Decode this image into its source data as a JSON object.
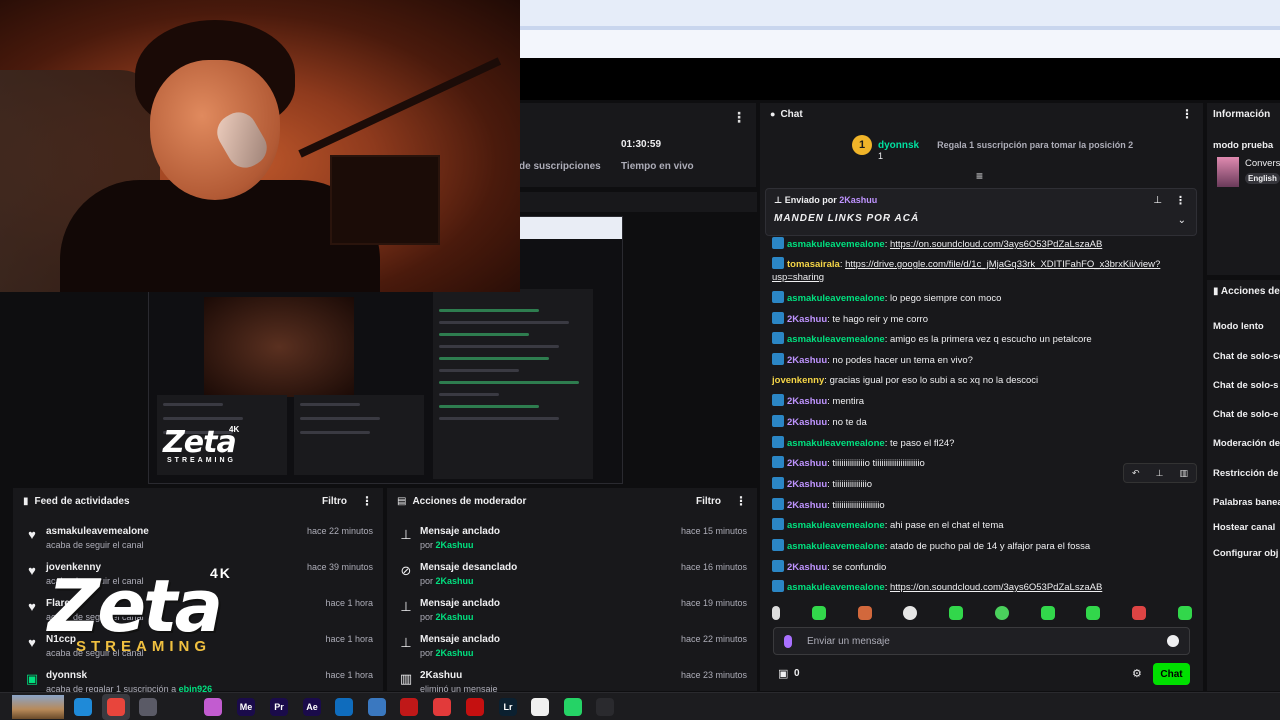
{
  "stats": {
    "subs_label": "de suscripciones",
    "time_value": "01:30:59",
    "time_label": "Tiempo en vivo"
  },
  "feed": {
    "title": "Feed de actividades",
    "filter": "Filtro",
    "items": [
      {
        "name": "asmakuleavemealone",
        "sub": "acaba de seguir el canal",
        "time": "hace 22 minutos"
      },
      {
        "name": "jovenkenny",
        "sub": "acaba de seguir el canal",
        "time": "hace 39 minutos"
      },
      {
        "name": "Flarex",
        "sub": "acaba de seguir el canal",
        "time": "hace 1 hora"
      },
      {
        "name": "N1ccp",
        "sub": "acaba de seguir el canal",
        "time": "hace 1 hora"
      },
      {
        "name": "dyonnsk",
        "sub": "acaba de regalar 1 suscripción a",
        "sub_user": "ebin926",
        "time": "hace 1 hora"
      }
    ]
  },
  "mod": {
    "title": "Acciones de moderador",
    "filter": "Filtro",
    "items": [
      {
        "name": "Mensaje anclado",
        "by": "por",
        "user": "2Kashuu",
        "time": "hace 15 minutos",
        "icon": "pin-icon"
      },
      {
        "name": "Mensaje desanclado",
        "by": "por",
        "user": "2Kashuu",
        "time": "hace 16 minutos",
        "icon": "unpin-icon"
      },
      {
        "name": "Mensaje anclado",
        "by": "por",
        "user": "2Kashuu",
        "time": "hace 19 minutos",
        "icon": "pin-icon"
      },
      {
        "name": "Mensaje anclado",
        "by": "por",
        "user": "2Kashuu",
        "time": "hace 22 minutos",
        "icon": "pin-icon"
      },
      {
        "name": "2Kashuu",
        "by": "eliminó un mensaje",
        "user": "",
        "time": "hace 23 minutos",
        "icon": "trash-icon"
      }
    ]
  },
  "chat": {
    "title": "Chat",
    "leader": {
      "rank": "1",
      "name": "dyonnsk",
      "count": "1",
      "gift_text": "Regala 1 suscripción para tomar la posición 2"
    },
    "pinned": {
      "by_label": "Enviado por",
      "by_user": "2Kashuu",
      "message": "MANDEN LINKS POR ACÁ"
    },
    "messages": [
      {
        "user": "asmakuleavemealone",
        "color": "green",
        "badge": true,
        "text": "https://on.soundcloud.com/3ays6O53PdZaLszaAB",
        "link": true
      },
      {
        "user": "tomasairala",
        "color": "yellow",
        "badge": true,
        "text": "https://drive.google.com/file/d/1c_jMjaGq33rk_XDITIFahFO_x3brxKii/view?usp=sharing",
        "link": true
      },
      {
        "user": "asmakuleavemealone",
        "color": "green",
        "badge": true,
        "text": "lo pego siempre con moco"
      },
      {
        "user": "2Kashuu",
        "color": "purple",
        "badge": true,
        "text": "te hago reir y me corro"
      },
      {
        "user": "asmakuleavemealone",
        "color": "green",
        "badge": true,
        "text": "amigo es la primera vez q escucho un petalcore"
      },
      {
        "user": "2Kashuu",
        "color": "purple",
        "badge": true,
        "text": "no podes hacer un tema en vivo?"
      },
      {
        "user": "jovenkenny",
        "color": "yellow",
        "badge": false,
        "text": "gracias igual por eso lo subi a sc xq no la descoci"
      },
      {
        "user": "2Kashuu",
        "color": "purple",
        "badge": true,
        "text": "mentira"
      },
      {
        "user": "2Kashuu",
        "color": "purple",
        "badge": true,
        "text": "no te da"
      },
      {
        "user": "asmakuleavemealone",
        "color": "green",
        "badge": true,
        "text": "te paso el fl24?"
      },
      {
        "user": "2Kashuu",
        "color": "purple",
        "badge": true,
        "text": "tiiiiiiiiiiiiiio tiiiiiiiiiiiiiiiiiiiiio"
      },
      {
        "user": "2Kashuu",
        "color": "purple",
        "badge": true,
        "text": "tiiiiiiiiiiiiiiio"
      },
      {
        "user": "2Kashuu",
        "color": "purple",
        "badge": true,
        "text": "tiiiiiiiiiiiiiiiiiiiiio"
      },
      {
        "user": "asmakuleavemealone",
        "color": "green",
        "badge": true,
        "text": "ahi pase en el chat el tema"
      },
      {
        "user": "asmakuleavemealone",
        "color": "green",
        "badge": true,
        "text": "atado de pucho pal de 14 y alfajor para el fossa"
      },
      {
        "user": "2Kashuu",
        "color": "purple",
        "badge": true,
        "text": "se confundio"
      },
      {
        "user": "asmakuleavemealone",
        "color": "green",
        "badge": true,
        "text": "https://on.soundcloud.com/3ays6O53PdZaLszaAB",
        "link": true
      }
    ],
    "input_placeholder": "Enviar un mensaje",
    "points": "0",
    "send_label": "Chat"
  },
  "info": {
    "title": "Información",
    "mode": "modo prueba",
    "conv": "Convers",
    "lang": "English"
  },
  "actions": {
    "title": "Acciones de",
    "items": [
      "Modo lento",
      "Chat de solo-se",
      "Chat de solo-s",
      "Chat de solo-e",
      "Moderación de",
      "Restricción de",
      "Palabras banea",
      "Hostear canal",
      "Configurar obj"
    ]
  },
  "overlay": {
    "logo": "Zeta",
    "tag": "4K",
    "sub": "STREAMING"
  },
  "preview": {
    "logo": "Zeta",
    "tag": "4K",
    "sub": "STREAMING"
  },
  "colors": {
    "green": "#00e07f",
    "purple": "#bf94ff",
    "yellow": "#f5d547",
    "accent": "#00e000",
    "badge": "#2b86c5"
  },
  "taskbar": {
    "icons": [
      {
        "name": "edge-icon",
        "label": "",
        "color": "#1f8ad8"
      },
      {
        "name": "chrome-icon",
        "label": "",
        "color": "#e8453c"
      },
      {
        "name": "store-icon",
        "label": "",
        "color": "#5a5a66"
      },
      {
        "name": "photos-icon",
        "label": "",
        "color": "#c25cd0"
      },
      {
        "name": "media-encoder-icon",
        "label": "Me",
        "color": "#1a0b4a"
      },
      {
        "name": "premiere-icon",
        "label": "Pr",
        "color": "#1a0b4a"
      },
      {
        "name": "after-effects-icon",
        "label": "Ae",
        "color": "#1a0b4a"
      },
      {
        "name": "outlook-icon",
        "label": "",
        "color": "#0f6cbd"
      },
      {
        "name": "globe-icon",
        "label": "",
        "color": "#3a78c0"
      },
      {
        "name": "mcafee-icon",
        "label": "",
        "color": "#c01818"
      },
      {
        "name": "anydesk-icon",
        "label": "",
        "color": "#e23a3a"
      },
      {
        "name": "acrobat-icon",
        "label": "",
        "color": "#c51010"
      },
      {
        "name": "lightroom-icon",
        "label": "Lr",
        "color": "#0b2030"
      },
      {
        "name": "capcut-icon",
        "label": "",
        "color": "#f0f0f0"
      },
      {
        "name": "whatsapp-icon",
        "label": "",
        "color": "#25d366"
      },
      {
        "name": "obs-icon",
        "label": "",
        "color": "#2a2a2e"
      }
    ]
  }
}
